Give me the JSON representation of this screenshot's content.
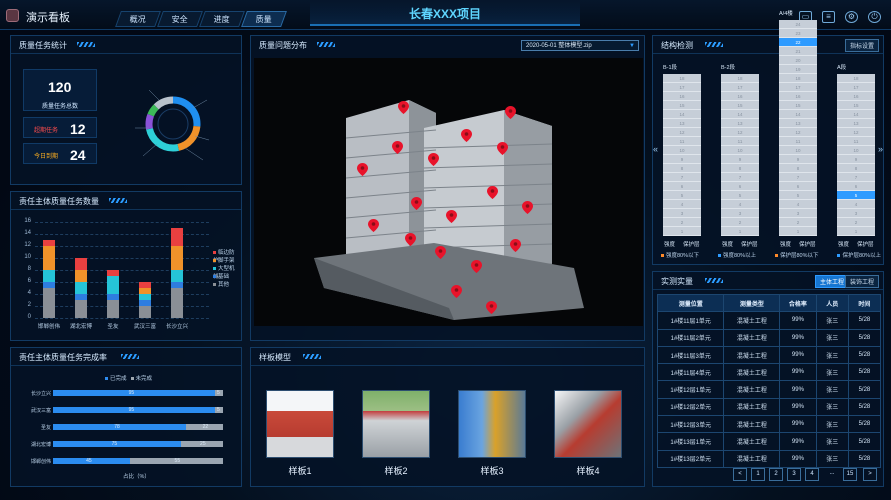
{
  "header": {
    "app_title": "演示看板",
    "tabs": [
      {
        "label": "概况"
      },
      {
        "label": "安全"
      },
      {
        "label": "进度"
      },
      {
        "label": "质量"
      }
    ],
    "main_title": "长春XXX项目",
    "icons": [
      "screen-icon",
      "document-icon",
      "settings-icon",
      "power-icon"
    ]
  },
  "quality_stats": {
    "title": "质量任务统计",
    "total": {
      "value": "120",
      "label": "质量任务总数"
    },
    "items": [
      {
        "label": "超期任务",
        "value": "12",
        "color": "#ff4d4d"
      },
      {
        "label": "今日到期",
        "value": "24",
        "color": "#ffb020"
      }
    ]
  },
  "subject_count": {
    "title": "责任主体质量任务数量",
    "chart_data": {
      "type": "bar",
      "stacked": true,
      "categories": [
        "邯郸创伟",
        "湖北宏博",
        "圣友",
        "武汉三富",
        "长沙立兴"
      ],
      "ylim": [
        0,
        16
      ],
      "yticks": [
        "0",
        "2",
        "4",
        "6",
        "8",
        "10",
        "12",
        "14",
        "16"
      ],
      "series": [
        {
          "name": "其他",
          "color": "#8a8f96",
          "values": [
            5,
            3,
            3,
            2,
            5
          ]
        },
        {
          "name": "基础",
          "color": "#2e7de0",
          "values": [
            1,
            1,
            1,
            1,
            1
          ]
        },
        {
          "name": "大型机械",
          "color": "#25c4d8",
          "values": [
            2,
            2,
            3,
            1,
            2
          ]
        },
        {
          "name": "脚手架",
          "color": "#f0922a",
          "values": [
            4,
            2,
            0,
            1,
            4
          ]
        },
        {
          "name": "临边防护",
          "color": "#e94040",
          "values": [
            1,
            2,
            1,
            1,
            3
          ]
        }
      ],
      "legend_position": "right"
    }
  },
  "completion_rate": {
    "title": "责任主体质量任务完成率",
    "chart_data": {
      "type": "bar",
      "orientation": "horizontal",
      "categories": [
        "长沙立兴",
        "武汉三富",
        "圣友",
        "湖北宏博",
        "邯郸创伟"
      ],
      "series": [
        {
          "name": "已完成",
          "color": "#2e8cf0",
          "values": [
            95,
            95,
            78,
            75,
            45
          ]
        },
        {
          "name": "未完成",
          "color": "#a0a8b0",
          "values": [
            5,
            5,
            22,
            25,
            55
          ]
        }
      ],
      "xlabel": "占比（%）"
    }
  },
  "issue_distribution": {
    "title": "质量问题分布",
    "select_value": "2020-05-01 整体模型.zip"
  },
  "sample_models": {
    "title": "样板模型",
    "items": [
      {
        "label": "样板1"
      },
      {
        "label": "样板2"
      },
      {
        "label": "样板3"
      },
      {
        "label": "样板4"
      }
    ]
  },
  "structure_monitor": {
    "title": "结构检测",
    "button": "指标设置",
    "columns": [
      {
        "label": "B-1段",
        "floors": [
          "18",
          "17",
          "16",
          "15",
          "14",
          "13",
          "12",
          "11",
          "10",
          "9",
          "8",
          "7",
          "6",
          "5",
          "4",
          "3",
          "2",
          "1"
        ]
      },
      {
        "label": "B-2段",
        "floors": [
          "18",
          "17",
          "16",
          "15",
          "14",
          "13",
          "12",
          "11",
          "10",
          "9",
          "8",
          "7",
          "6",
          "5",
          "4",
          "3",
          "2",
          "1"
        ]
      },
      {
        "label": "A/4楼",
        "floors": [
          "24",
          "23",
          "22",
          "21",
          "20",
          "19",
          "18",
          "17",
          "16",
          "15",
          "14",
          "13",
          "12",
          "11",
          "10",
          "9",
          "8",
          "7",
          "6",
          "5",
          "4",
          "3",
          "2",
          "1"
        ]
      },
      {
        "label": "A段",
        "floors": [
          "18",
          "17",
          "16",
          "15",
          "14",
          "13",
          "12",
          "11",
          "10",
          "9",
          "8",
          "7",
          "6",
          "5",
          "4",
          "3",
          "2",
          "1"
        ]
      }
    ],
    "col_footer": [
      "强度",
      "保护层"
    ],
    "legend": [
      {
        "label": "强度80%以下",
        "color": "#ff8a2a"
      },
      {
        "label": "强度80%以上",
        "color": "#2e9bff"
      },
      {
        "label": "保护层80%以下",
        "color": "#ff8a2a"
      },
      {
        "label": "保护层80%以上",
        "color": "#2e9bff"
      }
    ]
  },
  "measurement": {
    "title": "实测实量",
    "buttons": [
      "主体工程",
      "装饰工程"
    ],
    "headers": [
      "测量位置",
      "测量类型",
      "合格率",
      "人员",
      "时间"
    ],
    "rows": [
      [
        "1#楼11层1单元",
        "混凝土工程",
        "99%",
        "张三",
        "5/28"
      ],
      [
        "1#楼11层2单元",
        "混凝土工程",
        "99%",
        "张三",
        "5/28"
      ],
      [
        "1#楼11层3单元",
        "混凝土工程",
        "99%",
        "张三",
        "5/28"
      ],
      [
        "1#楼11层4单元",
        "混凝土工程",
        "99%",
        "张三",
        "5/28"
      ],
      [
        "1#楼12层1单元",
        "混凝土工程",
        "99%",
        "张三",
        "5/28"
      ],
      [
        "1#楼12层2单元",
        "混凝土工程",
        "99%",
        "张三",
        "5/28"
      ],
      [
        "1#楼12层3单元",
        "混凝土工程",
        "99%",
        "张三",
        "5/28"
      ],
      [
        "1#楼13层1单元",
        "混凝土工程",
        "99%",
        "张三",
        "5/28"
      ],
      [
        "1#楼13层2单元",
        "混凝土工程",
        "99%",
        "张三",
        "5/28"
      ]
    ],
    "pagination": [
      "<",
      "1",
      "2",
      "3",
      "4",
      "...",
      "15",
      ">"
    ]
  }
}
